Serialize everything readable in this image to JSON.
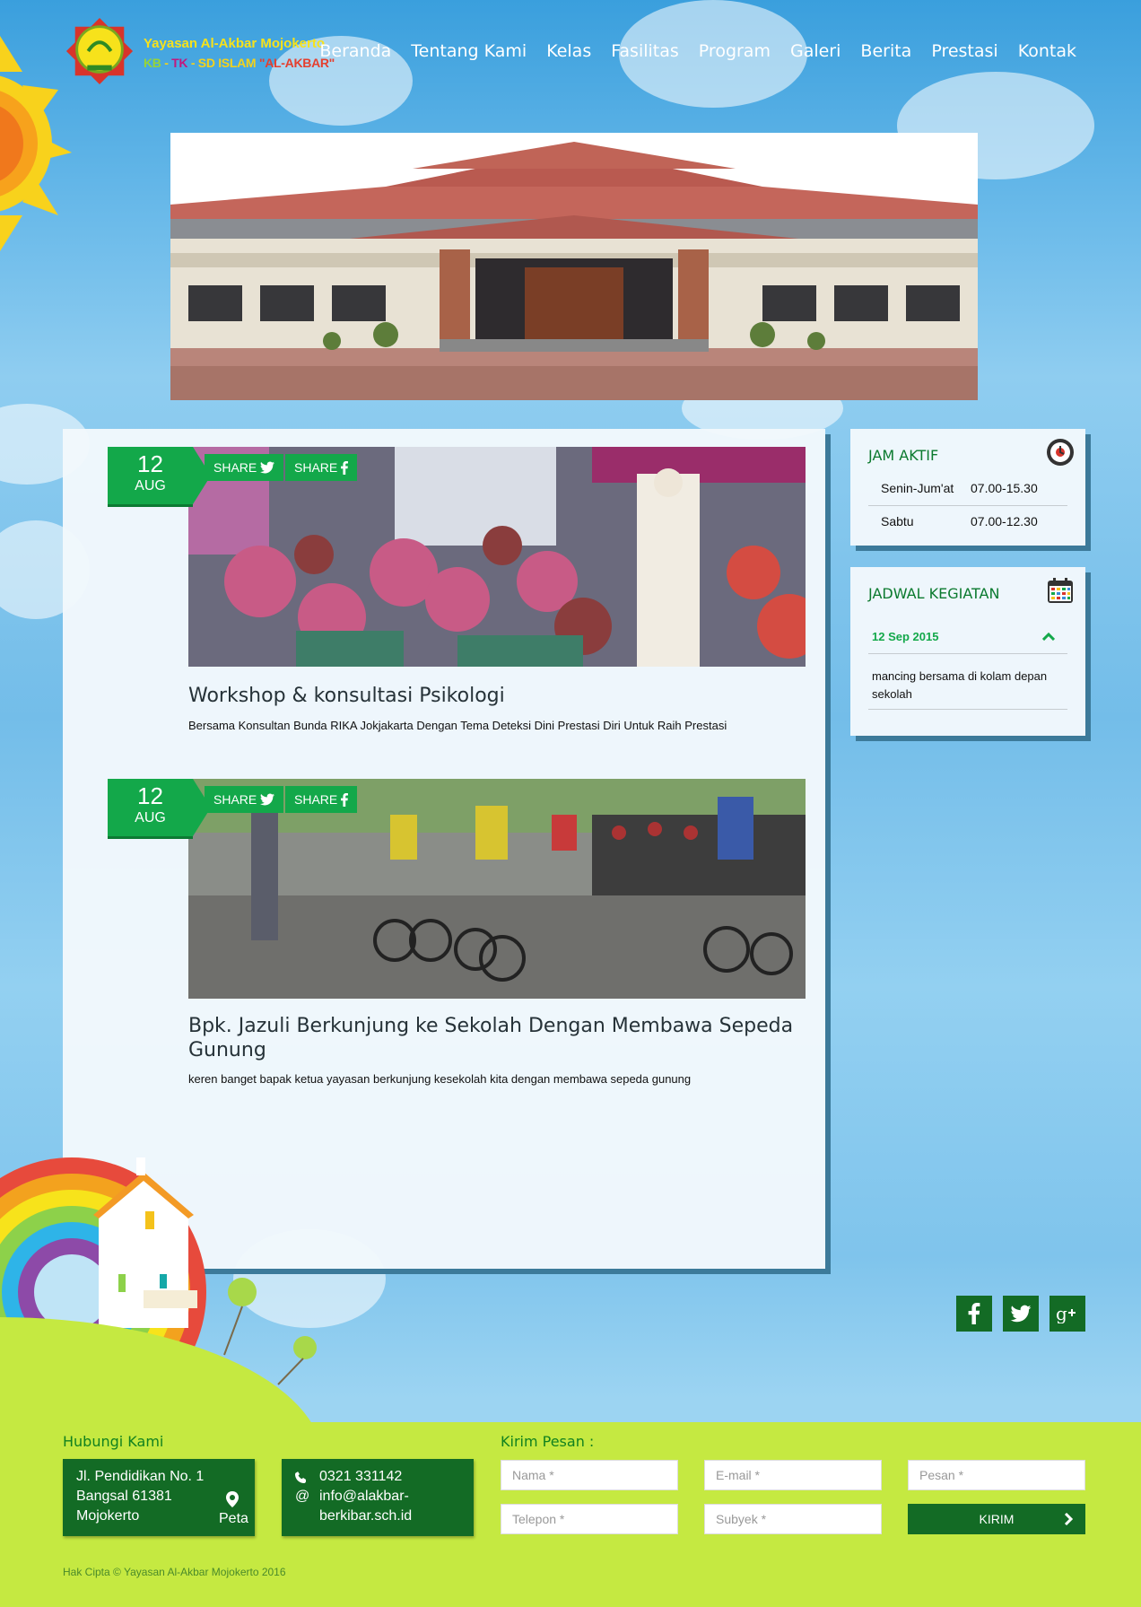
{
  "site": {
    "title": "Yayasan Al-Akbar Mojokerto",
    "subtitle": {
      "kb": "KB",
      "sep1": " - ",
      "tk": "TK",
      "sep2": " - ",
      "sd": "SD ISLAM",
      "ak": " \"AL-AKBAR\""
    }
  },
  "nav": [
    "Beranda",
    "Tentang Kami",
    "Kelas",
    "Fasilitas",
    "Program",
    "Galeri",
    "Berita",
    "Prestasi",
    "Kontak"
  ],
  "posts": [
    {
      "day": "12",
      "month": "AUG",
      "share_twitter": "SHARE",
      "share_facebook": "SHARE",
      "title": "Workshop & konsultasi Psikologi",
      "description": "Bersama Konsultan Bunda RIKA Jokjakarta Dengan Tema Deteksi Dini Prestasi Diri Untuk Raih Prestasi"
    },
    {
      "day": "12",
      "month": "AUG",
      "share_twitter": "SHARE",
      "share_facebook": "SHARE",
      "title": "Bpk. Jazuli Berkunjung ke Sekolah Dengan Membawa Sepeda Gunung",
      "description": "keren banget bapak ketua yayasan berkunjung kesekolah kita dengan membawa sepeda gunung"
    }
  ],
  "jam_aktif": {
    "title": "JAM AKTIF",
    "rows": [
      {
        "day": "Senin-Jum'at",
        "time": "07.00-15.30"
      },
      {
        "day": "Sabtu",
        "time": "07.00-12.30"
      }
    ]
  },
  "jadwal": {
    "title": "JADWAL KEGIATAN",
    "date": "12 Sep 2015",
    "body": "mancing bersama di kolam depan sekolah"
  },
  "footer": {
    "contact_heading": "Hubungi Kami",
    "address": [
      "Jl. Pendidikan No. 1",
      "Bangsal 61381",
      "Mojokerto"
    ],
    "map_label": "Peta",
    "phone": "0321 331142",
    "email_line1": "info@alakbar-",
    "email_line2": "berkibar.sch.id",
    "form_heading": "Kirim Pesan :",
    "placeholders": {
      "nama": "Nama *",
      "email": "E-mail *",
      "pesan": "Pesan *",
      "telepon": "Telepon *",
      "subyek": "Subyek *"
    },
    "send_label": "KIRIM",
    "copyright": "Hak Cipta © Yayasan Al-Akbar Mojokerto 2016"
  },
  "colors": {
    "accent_green": "#13a84a",
    "dark_green": "#136b25",
    "footer_lime": "#c5e941",
    "title_green": "#0b7a2e"
  }
}
